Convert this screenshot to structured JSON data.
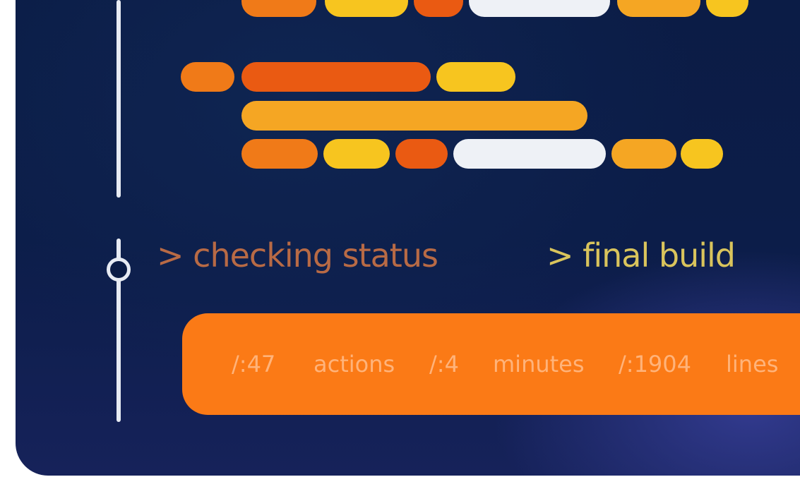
{
  "pipeline": {
    "status_prompt": ">",
    "status_label": "checking status",
    "build_prompt": ">",
    "build_label": "final build"
  },
  "stats": {
    "actions_value": "/:47",
    "actions_unit": "actions",
    "minutes_value": "/:4",
    "minutes_unit": "minutes",
    "lines_value": "/:1904",
    "lines_unit": "lines"
  },
  "colors": {
    "panel_background": "#0b1c45",
    "accent_orange": "#fb7a16",
    "bar_orange": "#f07a18",
    "bar_red_orange": "#ea5a12",
    "bar_yellow": "#f7c51f",
    "bar_amber": "#f5a623",
    "bar_white": "#eef1f6",
    "timeline": "#e7ebf3",
    "status_text": "#b86a45",
    "build_text": "#d9c45c"
  },
  "icons": {
    "timeline_node": "circle-node-icon"
  }
}
